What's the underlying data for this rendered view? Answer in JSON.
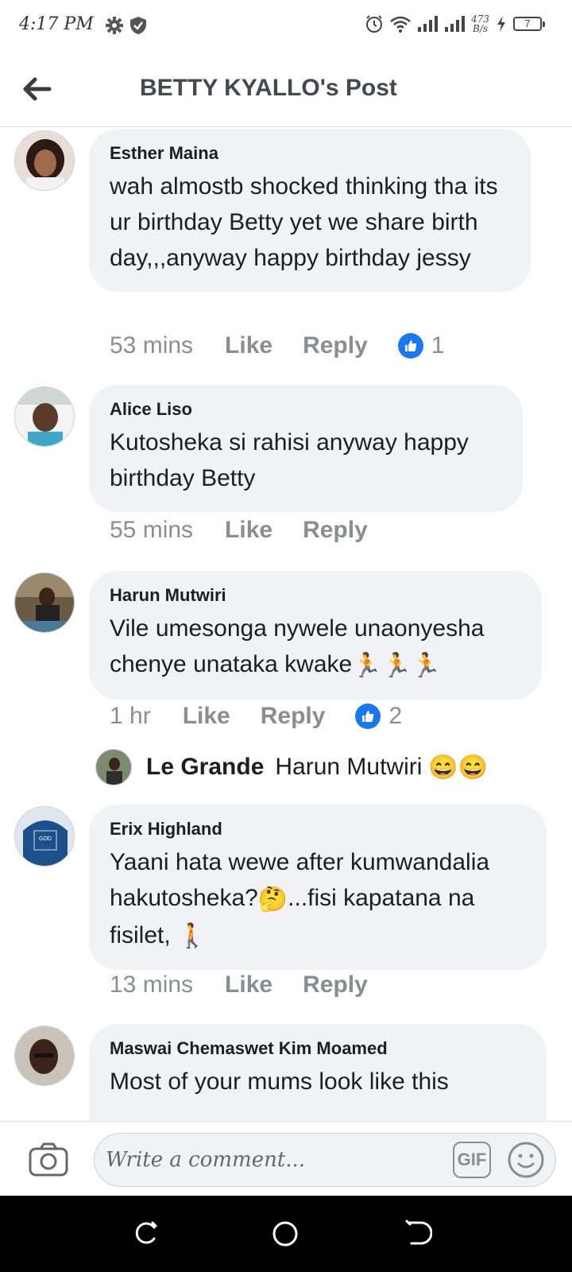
{
  "status_bar": {
    "time": "4:17 PM",
    "speed_top": "473",
    "speed_bottom": "B/s",
    "battery": "7",
    "icons": [
      "gear-icon",
      "shield-icon",
      "alarm-icon",
      "wifi-icon",
      "signal-icon",
      "signal-icon",
      "charging-icon",
      "battery-icon"
    ]
  },
  "header": {
    "title": "BETTY KYALLO's Post",
    "back_icon": "back-arrow-icon"
  },
  "comments": [
    {
      "author": "Esther Maina",
      "text": "wah almostb shocked thinking tha its ur birthday Betty yet we share birth day,,,anyway happy birthday jessy",
      "time": "53 mins",
      "like": "Like",
      "reply": "Reply",
      "reactions": "1"
    },
    {
      "author": "Alice Liso",
      "text": "Kutosheka si rahisi anyway happy birthday Betty",
      "time": "55 mins",
      "like": "Like",
      "reply": "Reply"
    },
    {
      "author": "Harun Mutwiri",
      "text": "Vile umesonga nywele unaonyesha chenye unataka kwake",
      "emoji": "🏃🏃🏃",
      "time": "1 hr",
      "like": "Like",
      "reply": "Reply",
      "reactions": "2"
    },
    {
      "author": "Erix Highland",
      "text_part1": "Yaani hata wewe after kumwandalia hakutosheka?",
      "emoji1": "🤔",
      "text_part2": "...fisi kapatana na fisilet,",
      "emoji2": "🚶",
      "time": "13 mins",
      "like": "Like",
      "reply": "Reply"
    },
    {
      "author": "Maswai Chemaswet Kim Moamed",
      "text": "Most of your mums look like this"
    }
  ],
  "reply_preview": {
    "author": "Le Grande",
    "text": "Harun Mutwiri",
    "emoji": "😄😄"
  },
  "composer": {
    "placeholder": "Write a comment...",
    "gif_label": "GIF"
  },
  "colors": {
    "bubble": "#f0f2f5",
    "muted": "#8a8d91",
    "like_blue": "#1877f2"
  }
}
